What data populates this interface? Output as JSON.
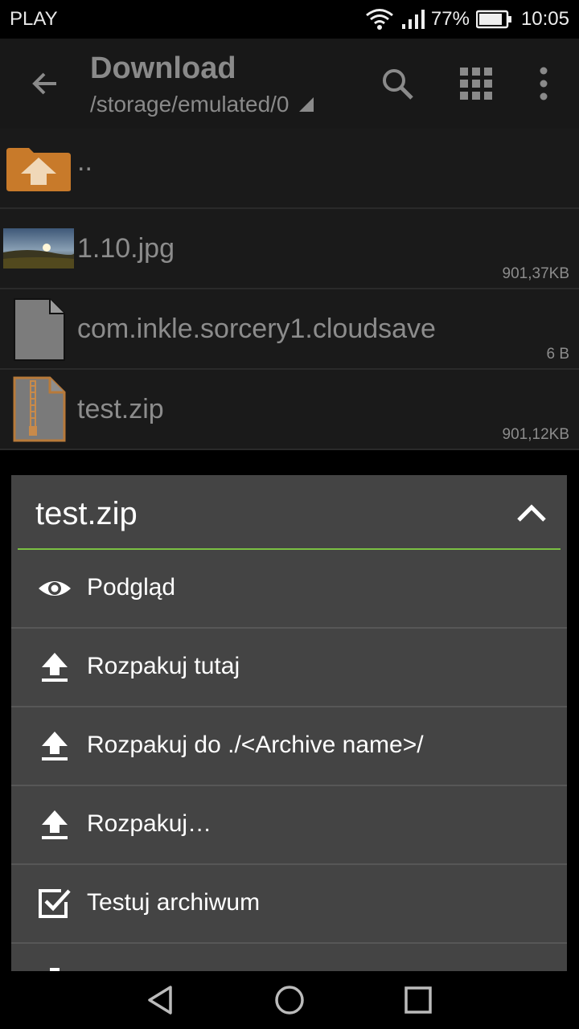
{
  "status": {
    "carrier": "PLAY",
    "battery": "77%",
    "time": "10:05"
  },
  "toolbar": {
    "title": "Download",
    "path": "/storage/emulated/0"
  },
  "files": [
    {
      "name": "..",
      "size": ""
    },
    {
      "name": "1.10.jpg",
      "size": "901,37KB"
    },
    {
      "name": "com.inkle.sorcery1.cloudsave",
      "size": "6 B"
    },
    {
      "name": "test.zip",
      "size": "901,12KB"
    }
  ],
  "popup": {
    "title": "test.zip",
    "items": [
      {
        "label": "Podgląd",
        "icon": "eye-icon"
      },
      {
        "label": "Rozpakuj tutaj",
        "icon": "extract-icon"
      },
      {
        "label": "Rozpakuj do ./<Archive name>/",
        "icon": "extract-icon"
      },
      {
        "label": "Rozpakuj…",
        "icon": "extract-icon"
      },
      {
        "label": "Testuj archiwum",
        "icon": "checkbox-icon"
      }
    ]
  },
  "colors": {
    "accent": "#7bc043",
    "popup_bg": "#444444",
    "list_bg": "#1a1a1a",
    "folder": "#c87a2a"
  }
}
